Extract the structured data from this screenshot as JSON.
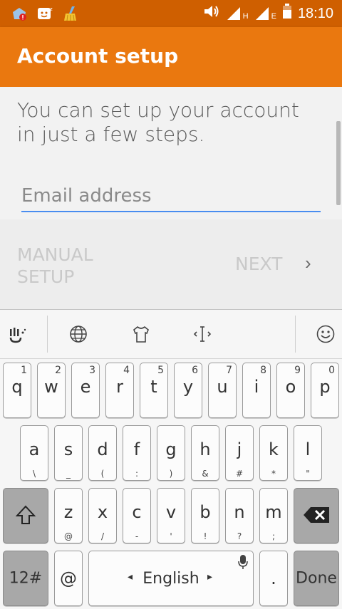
{
  "status_bar": {
    "icons_left": [
      "store-alert-icon",
      "smiley-notification-icon",
      "cleaner-icon"
    ],
    "volume_icon": "volume-icon",
    "sim1_label": "H",
    "sim2_label": "E",
    "battery_icon": "battery-icon",
    "time": "18:10"
  },
  "app_bar": {
    "title": "Account setup"
  },
  "content": {
    "intro": "You can set up your account in just a few steps.",
    "email_placeholder": "Email address",
    "email_value": "",
    "manual_setup": "MANUAL SETUP",
    "next": "NEXT",
    "next_chevron": "›"
  },
  "keyboard": {
    "toolbar": [
      "voice-hand-icon",
      "globe-icon",
      "theme-shirt-icon",
      "cursor-icon",
      "emoji-icon"
    ],
    "row1": [
      {
        "main": "q",
        "hint": "1"
      },
      {
        "main": "w",
        "hint": "2"
      },
      {
        "main": "e",
        "hint": "3"
      },
      {
        "main": "r",
        "hint": "4"
      },
      {
        "main": "t",
        "hint": "5"
      },
      {
        "main": "y",
        "hint": "6"
      },
      {
        "main": "u",
        "hint": "7"
      },
      {
        "main": "i",
        "hint": "8"
      },
      {
        "main": "o",
        "hint": "9"
      },
      {
        "main": "p",
        "hint": "0"
      }
    ],
    "row2": [
      {
        "main": "a",
        "sub": "\\"
      },
      {
        "main": "s",
        "sub": "_"
      },
      {
        "main": "d",
        "sub": "("
      },
      {
        "main": "f",
        "sub": ":"
      },
      {
        "main": "g",
        "sub": ")"
      },
      {
        "main": "h",
        "sub": "&"
      },
      {
        "main": "j",
        "sub": "#"
      },
      {
        "main": "k",
        "sub": "*"
      },
      {
        "main": "l",
        "sub": "\""
      }
    ],
    "row3": [
      {
        "main": "z",
        "sub": "@"
      },
      {
        "main": "x",
        "sub": "/"
      },
      {
        "main": "c",
        "sub": "-"
      },
      {
        "main": "v",
        "sub": "'"
      },
      {
        "main": "b",
        "sub": "!"
      },
      {
        "main": "n",
        "sub": "?"
      },
      {
        "main": "m",
        "sub": ";"
      }
    ],
    "mode_key": "12#",
    "at_key": "@",
    "space_label": "English",
    "space_left_arrow": "◂",
    "space_right_arrow": "▸",
    "period_key": ".",
    "done_key": "Done"
  }
}
